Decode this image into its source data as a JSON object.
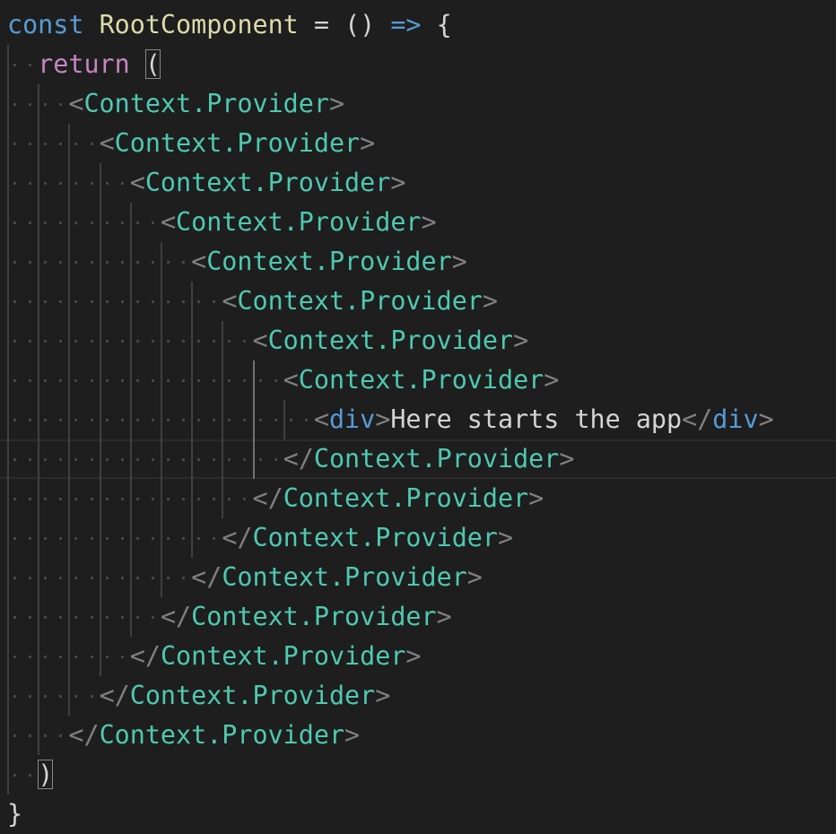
{
  "editor": {
    "language": "javascript-jsx",
    "theme_colors": {
      "background": "#1e1e1e",
      "keyword": "#569cd6",
      "control_keyword": "#c586c0",
      "function_name": "#dcdcaa",
      "component": "#4ec9b0",
      "tag_punctuation": "#808080",
      "text": "#d4d4d4"
    },
    "lines": [
      {
        "indent": 0,
        "tokens": [
          {
            "t": "const",
            "c": "kw"
          },
          {
            "t": " ",
            "c": "op"
          },
          {
            "t": "RootComponent",
            "c": "fn"
          },
          {
            "t": " = ",
            "c": "op"
          },
          {
            "t": "()",
            "c": "punc"
          },
          {
            "t": " ",
            "c": "op"
          },
          {
            "t": "=>",
            "c": "kw"
          },
          {
            "t": " {",
            "c": "punc"
          }
        ]
      },
      {
        "indent": 1,
        "tokens": [
          {
            "t": "return",
            "c": "kw-ctrl"
          },
          {
            "t": " ",
            "c": "op"
          },
          {
            "t": "(",
            "c": "punc",
            "match": true
          }
        ]
      },
      {
        "indent": 2,
        "tokens": [
          {
            "t": "<",
            "c": "tag-punc"
          },
          {
            "t": "Context.Provider",
            "c": "comp"
          },
          {
            "t": ">",
            "c": "tag-punc"
          }
        ]
      },
      {
        "indent": 3,
        "tokens": [
          {
            "t": "<",
            "c": "tag-punc"
          },
          {
            "t": "Context.Provider",
            "c": "comp"
          },
          {
            "t": ">",
            "c": "tag-punc"
          }
        ]
      },
      {
        "indent": 4,
        "tokens": [
          {
            "t": "<",
            "c": "tag-punc"
          },
          {
            "t": "Context.Provider",
            "c": "comp"
          },
          {
            "t": ">",
            "c": "tag-punc"
          }
        ]
      },
      {
        "indent": 5,
        "tokens": [
          {
            "t": "<",
            "c": "tag-punc"
          },
          {
            "t": "Context.Provider",
            "c": "comp"
          },
          {
            "t": ">",
            "c": "tag-punc"
          }
        ]
      },
      {
        "indent": 6,
        "tokens": [
          {
            "t": "<",
            "c": "tag-punc"
          },
          {
            "t": "Context.Provider",
            "c": "comp"
          },
          {
            "t": ">",
            "c": "tag-punc"
          }
        ]
      },
      {
        "indent": 7,
        "tokens": [
          {
            "t": "<",
            "c": "tag-punc"
          },
          {
            "t": "Context.Provider",
            "c": "comp"
          },
          {
            "t": ">",
            "c": "tag-punc"
          }
        ]
      },
      {
        "indent": 8,
        "tokens": [
          {
            "t": "<",
            "c": "tag-punc"
          },
          {
            "t": "Context.Provider",
            "c": "comp"
          },
          {
            "t": ">",
            "c": "tag-punc"
          }
        ]
      },
      {
        "indent": 9,
        "tokens": [
          {
            "t": "<",
            "c": "tag-punc"
          },
          {
            "t": "Context.Provider",
            "c": "comp"
          },
          {
            "t": ">",
            "c": "tag-punc"
          }
        ]
      },
      {
        "indent": 10,
        "tokens": [
          {
            "t": "<",
            "c": "tag-punc"
          },
          {
            "t": "div",
            "c": "html-tag"
          },
          {
            "t": ">",
            "c": "tag-punc"
          },
          {
            "t": "Here starts the app",
            "c": "text"
          },
          {
            "t": "</",
            "c": "tag-punc"
          },
          {
            "t": "div",
            "c": "html-tag"
          },
          {
            "t": ">",
            "c": "tag-punc"
          }
        ]
      },
      {
        "indent": 9,
        "current": true,
        "tokens": [
          {
            "t": "</",
            "c": "tag-punc"
          },
          {
            "t": "Context.Provider",
            "c": "comp"
          },
          {
            "t": ">",
            "c": "tag-punc"
          }
        ]
      },
      {
        "indent": 8,
        "tokens": [
          {
            "t": "</",
            "c": "tag-punc"
          },
          {
            "t": "Context.Provider",
            "c": "comp"
          },
          {
            "t": ">",
            "c": "tag-punc"
          }
        ]
      },
      {
        "indent": 7,
        "tokens": [
          {
            "t": "</",
            "c": "tag-punc"
          },
          {
            "t": "Context.Provider",
            "c": "comp"
          },
          {
            "t": ">",
            "c": "tag-punc"
          }
        ]
      },
      {
        "indent": 6,
        "tokens": [
          {
            "t": "</",
            "c": "tag-punc"
          },
          {
            "t": "Context.Provider",
            "c": "comp"
          },
          {
            "t": ">",
            "c": "tag-punc"
          }
        ]
      },
      {
        "indent": 5,
        "tokens": [
          {
            "t": "</",
            "c": "tag-punc"
          },
          {
            "t": "Context.Provider",
            "c": "comp"
          },
          {
            "t": ">",
            "c": "tag-punc"
          }
        ]
      },
      {
        "indent": 4,
        "tokens": [
          {
            "t": "</",
            "c": "tag-punc"
          },
          {
            "t": "Context.Provider",
            "c": "comp"
          },
          {
            "t": ">",
            "c": "tag-punc"
          }
        ]
      },
      {
        "indent": 3,
        "tokens": [
          {
            "t": "</",
            "c": "tag-punc"
          },
          {
            "t": "Context.Provider",
            "c": "comp"
          },
          {
            "t": ">",
            "c": "tag-punc"
          }
        ]
      },
      {
        "indent": 2,
        "tokens": [
          {
            "t": "</",
            "c": "tag-punc"
          },
          {
            "t": "Context.Provider",
            "c": "comp"
          },
          {
            "t": ">",
            "c": "tag-punc"
          }
        ]
      },
      {
        "indent": 1,
        "tokens": [
          {
            "t": ")",
            "c": "punc",
            "match": true
          }
        ]
      },
      {
        "indent": 0,
        "tokens": [
          {
            "t": "}",
            "c": "punc"
          }
        ]
      }
    ]
  }
}
